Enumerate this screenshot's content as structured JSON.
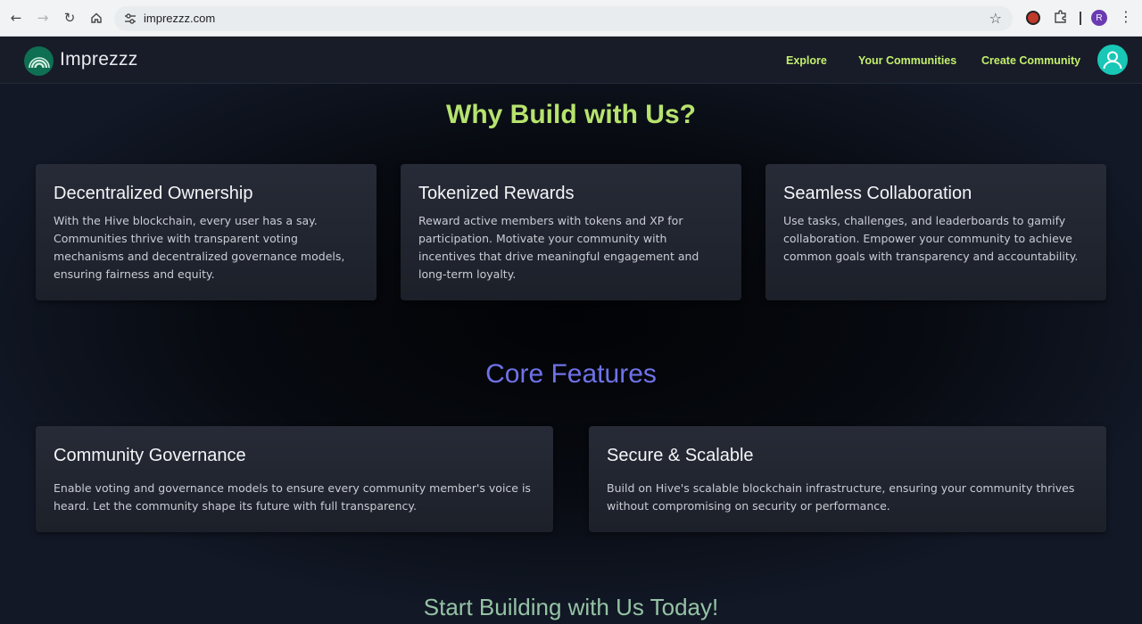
{
  "browser": {
    "url": "imprezzz.com",
    "profile_initial": "R",
    "icons": [
      "back-icon",
      "forward-icon",
      "reload-icon",
      "home-icon",
      "site-settings-icon",
      "star-icon",
      "extension-icon",
      "puzzle-icon",
      "menu-icon"
    ]
  },
  "header": {
    "brand": "Imprezzz",
    "nav": [
      {
        "label": "Explore"
      },
      {
        "label": "Your Communities"
      },
      {
        "label": "Create Community"
      }
    ]
  },
  "why": {
    "title": "Why Build with Us?",
    "cards": [
      {
        "title": "Decentralized Ownership",
        "body": "With the Hive blockchain, every user has a say. Communities thrive with transparent voting mechanisms and decentralized governance models, ensuring fairness and equity."
      },
      {
        "title": "Tokenized Rewards",
        "body": "Reward active members with tokens and XP for participation. Motivate your community with incentives that drive meaningful engagement and long-term loyalty."
      },
      {
        "title": "Seamless Collaboration",
        "body": "Use tasks, challenges, and leaderboards to gamify collaboration. Empower your community to achieve common goals with transparency and accountability."
      }
    ]
  },
  "core": {
    "title": "Core Features",
    "cards": [
      {
        "title": "Community Governance",
        "body": "Enable voting and governance models to ensure every community member's voice is heard. Let the community shape its future with full transparency."
      },
      {
        "title": "Secure & Scalable",
        "body": "Build on Hive's scalable blockchain infrastructure, ensuring your community thrives without compromising on security or performance."
      }
    ]
  },
  "cta": {
    "title": "Start Building with Us Today!"
  },
  "colors": {
    "accent_green": "#c4ef6c",
    "heading_green": "#b7e36e",
    "heading_purple": "#6f72e8",
    "avatar_teal": "#18c7b6"
  }
}
